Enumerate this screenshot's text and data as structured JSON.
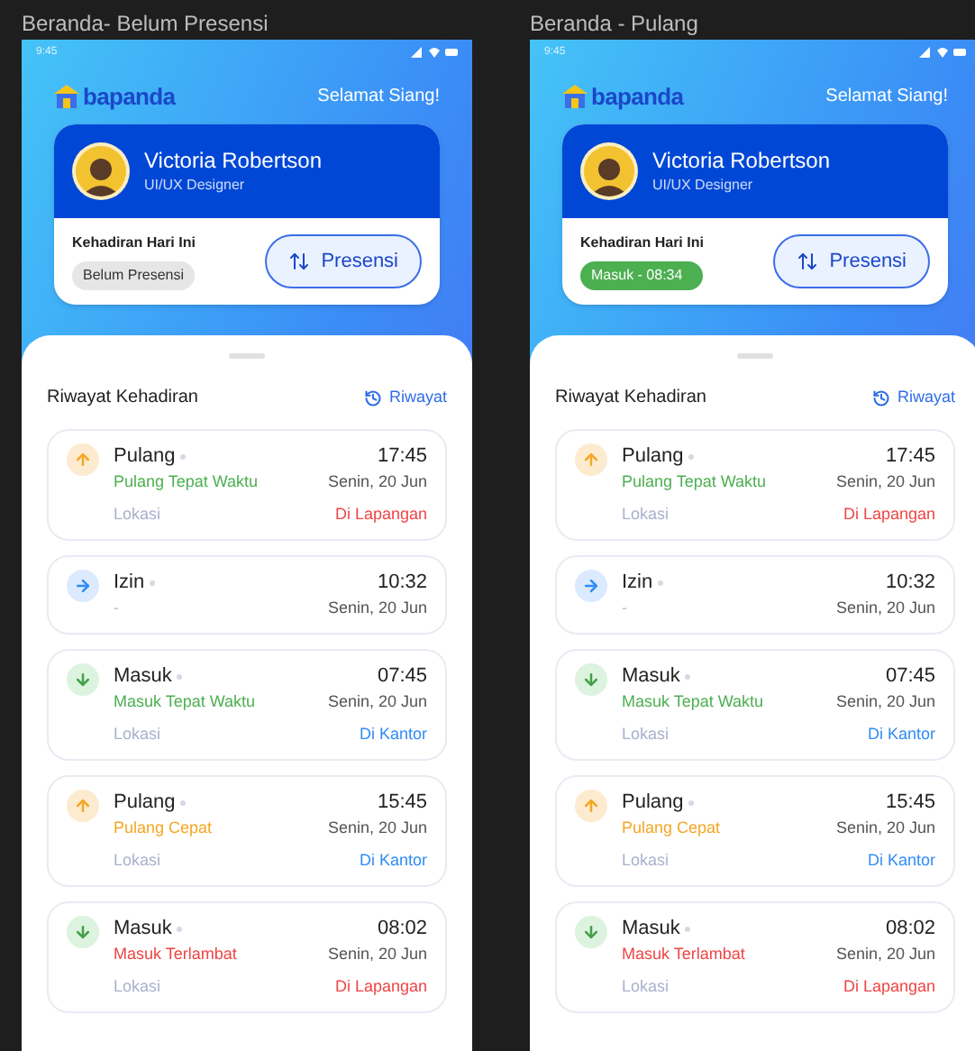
{
  "frames": [
    {
      "title": "Beranda- Belum Presensi",
      "status_time": "9:45",
      "logo": "bapanda",
      "greeting": "Selamat Siang!",
      "profile": {
        "name": "Victoria Robertson",
        "role": "UI/UX Designer"
      },
      "attendance": {
        "label": "Kehadiran Hari Ini",
        "badge": {
          "text": "Belum Presensi",
          "kind": "pending"
        },
        "button": "Presensi"
      },
      "history": {
        "title": "Riwayat Kehadiran",
        "link": "Riwayat",
        "records": [
          {
            "type": "Pulang",
            "kind": "out",
            "status": {
              "text": "Pulang Tepat Waktu",
              "color": "#4caf50"
            },
            "time": "17:45",
            "date": "Senin, 20 Jun",
            "location": {
              "label": "Lokasi",
              "value": "Di Lapangan",
              "color": "#ef4444"
            }
          },
          {
            "type": "Izin",
            "kind": "leave",
            "status": {
              "text": "-",
              "color": "#b8c0d8"
            },
            "time": "10:32",
            "date": "Senin, 20 Jun"
          },
          {
            "type": "Masuk",
            "kind": "in",
            "status": {
              "text": "Masuk Tepat Waktu",
              "color": "#4caf50"
            },
            "time": "07:45",
            "date": "Senin, 20 Jun",
            "location": {
              "label": "Lokasi",
              "value": "Di Kantor",
              "color": "#2f8cf5"
            }
          },
          {
            "type": "Pulang",
            "kind": "out",
            "status": {
              "text": "Pulang Cepat",
              "color": "#f5a623"
            },
            "time": "15:45",
            "date": "Senin, 20 Jun",
            "location": {
              "label": "Lokasi",
              "value": "Di Kantor",
              "color": "#2f8cf5"
            }
          },
          {
            "type": "Masuk",
            "kind": "in",
            "status": {
              "text": "Masuk Terlambat",
              "color": "#ef4444"
            },
            "time": "08:02",
            "date": "Senin, 20 Jun",
            "location": {
              "label": "Lokasi",
              "value": "Di Lapangan",
              "color": "#ef4444"
            }
          }
        ]
      }
    },
    {
      "title": "Beranda - Pulang",
      "status_time": "9:45",
      "logo": "bapanda",
      "greeting": "Selamat Siang!",
      "profile": {
        "name": "Victoria Robertson",
        "role": "UI/UX Designer"
      },
      "attendance": {
        "label": "Kehadiran Hari Ini",
        "badge": {
          "text": "Masuk - 08:34",
          "kind": "checked_in"
        },
        "button": "Presensi"
      },
      "history": {
        "title": "Riwayat Kehadiran",
        "link": "Riwayat",
        "records": [
          {
            "type": "Pulang",
            "kind": "out",
            "status": {
              "text": "Pulang Tepat Waktu",
              "color": "#4caf50"
            },
            "time": "17:45",
            "date": "Senin, 20 Jun",
            "location": {
              "label": "Lokasi",
              "value": "Di Lapangan",
              "color": "#ef4444"
            }
          },
          {
            "type": "Izin",
            "kind": "leave",
            "status": {
              "text": "-",
              "color": "#b8c0d8"
            },
            "time": "10:32",
            "date": "Senin, 20 Jun"
          },
          {
            "type": "Masuk",
            "kind": "in",
            "status": {
              "text": "Masuk Tepat Waktu",
              "color": "#4caf50"
            },
            "time": "07:45",
            "date": "Senin, 20 Jun",
            "location": {
              "label": "Lokasi",
              "value": "Di Kantor",
              "color": "#2f8cf5"
            }
          },
          {
            "type": "Pulang",
            "kind": "out",
            "status": {
              "text": "Pulang Cepat",
              "color": "#f5a623"
            },
            "time": "15:45",
            "date": "Senin, 20 Jun",
            "location": {
              "label": "Lokasi",
              "value": "Di Kantor",
              "color": "#2f8cf5"
            }
          },
          {
            "type": "Masuk",
            "kind": "in",
            "status": {
              "text": "Masuk Terlambat",
              "color": "#ef4444"
            },
            "time": "08:02",
            "date": "Senin, 20 Jun",
            "location": {
              "label": "Lokasi",
              "value": "Di Lapangan",
              "color": "#ef4444"
            }
          }
        ]
      }
    }
  ]
}
